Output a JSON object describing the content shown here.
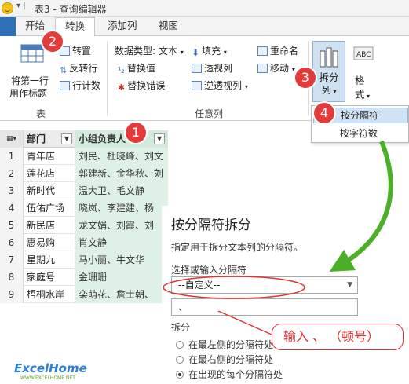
{
  "titlebar": {
    "arrow": "▾ |",
    "title": "表3 - 查询编辑器"
  },
  "tabs": {
    "home": "开始",
    "transform": "转换",
    "add_column": "添加列",
    "view": "视图"
  },
  "ribbon": {
    "table_group": {
      "first_row_header": "将第一行",
      "first_row_header2": "用作标题",
      "transpose": "转置",
      "reverse_rows": "反转行",
      "count_rows": "行计数",
      "label": "表"
    },
    "any_column_group": {
      "data_type": "数据类型: 文本",
      "fill": "填充",
      "rename": "重命名",
      "replace_values": "替换值",
      "pivot_column": "透视列",
      "move": "移动",
      "replace_errors": "替换错误",
      "unpivot_columns": "逆透视列",
      "label": "任意列"
    },
    "split_column": {
      "label1": "拆分",
      "label2": "列"
    },
    "format": {
      "label1": "格",
      "label2": "式"
    }
  },
  "split_menu": {
    "by_delimiter": "按分隔符",
    "by_count": "按字符数"
  },
  "grid": {
    "headers": {
      "dept": "部门",
      "members": "小组负责人"
    },
    "rows": [
      {
        "idx": "1",
        "dept": "青年店",
        "members": "刘民、杜晓峰、刘文"
      },
      {
        "idx": "2",
        "dept": "莲花店",
        "members": "郭建新、金华秋、刘"
      },
      {
        "idx": "3",
        "dept": "新时代",
        "members": "温大卫、毛文静"
      },
      {
        "idx": "4",
        "dept": "伍佑广场",
        "members": "晓岚、李建建、杨"
      },
      {
        "idx": "5",
        "dept": "新民店",
        "members": "龙文娟、刘霞、刘"
      },
      {
        "idx": "6",
        "dept": "惠易购",
        "members": "肖文静"
      },
      {
        "idx": "7",
        "dept": "星期九",
        "members": "马小丽、牛文华"
      },
      {
        "idx": "8",
        "dept": "家庭号",
        "members": "金珊珊"
      },
      {
        "idx": "9",
        "dept": "梧桐水岸",
        "members": "栾萌花、詹士朝、"
      }
    ]
  },
  "dialog": {
    "title": "按分隔符拆分",
    "description": "指定用于拆分文本列的分隔符。",
    "select_label": "选择或输入分隔符",
    "select_value": "--自定义--",
    "input_value": "、",
    "split_label": "拆分",
    "radio_left": "在最左侧的分隔符处",
    "radio_right": "在最右侧的分隔符处",
    "radio_each": "在出现的每个分隔符处"
  },
  "annotations": {
    "step1": "1",
    "step2": "2",
    "step3": "3",
    "step4": "4",
    "note": "输入 、 （顿号）",
    "accent_red": "#e23b3b",
    "arrow_green": "#4caf28"
  },
  "logo": {
    "text": "ExcelHome",
    "sub": "WWW.EXCELHOME.NET"
  }
}
